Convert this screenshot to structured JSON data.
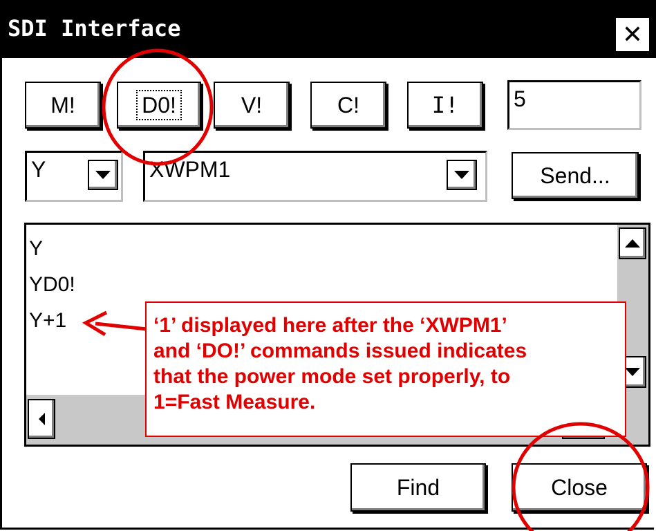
{
  "window": {
    "title": "SDI Interface",
    "close_glyph": "✕"
  },
  "command_buttons": [
    {
      "label": "M!"
    },
    {
      "label": "D0!"
    },
    {
      "label": "V!"
    },
    {
      "label": "C!"
    },
    {
      "label": "I!"
    }
  ],
  "count_field": {
    "value": "5"
  },
  "address_select": {
    "value": "Y"
  },
  "command_select": {
    "value": "XWPM1"
  },
  "send_button": {
    "label": "Send..."
  },
  "log": {
    "lines": [
      "Y",
      "YD0!",
      "Y+1"
    ]
  },
  "annotation": {
    "lines": [
      "‘1’ displayed here after the ‘XWPM1’",
      "and ‘DO!’ commands issued indicates",
      "that the power mode set properly, to",
      "1=Fast Measure."
    ],
    "color": "#e00000"
  },
  "footer": {
    "find_label": "Find",
    "close_label": "Close"
  },
  "icons": [
    "close-icon",
    "dropdown-arrow-icon",
    "scroll-up-icon",
    "scroll-down-icon",
    "scroll-left-icon"
  ]
}
